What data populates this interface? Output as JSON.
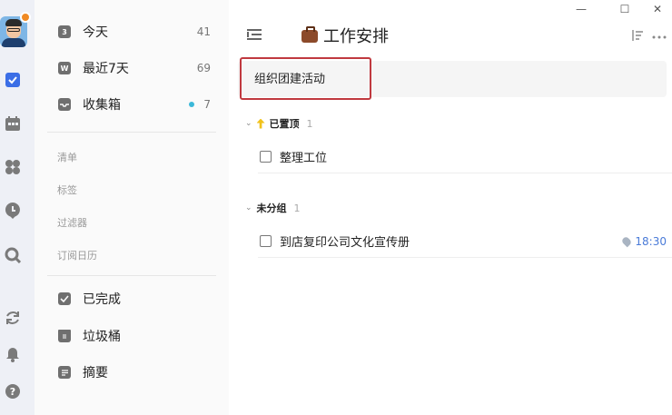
{
  "window": {
    "minimize_glyph": "—",
    "maximize_glyph": "☐",
    "close_glyph": "✕"
  },
  "rail": {
    "icons": [
      "tasks-check-icon",
      "calendar-icon",
      "apps-icon",
      "clock-icon",
      "search-icon",
      "sync-icon",
      "bell-icon",
      "help-icon"
    ],
    "accent": "#3b6ee6"
  },
  "sidebar": {
    "smart_lists": [
      {
        "label": "今天",
        "count": "41",
        "icon": "today-icon",
        "icon_text": "3"
      },
      {
        "label": "最近7天",
        "count": "69",
        "icon": "next7days-icon",
        "icon_text": "W"
      },
      {
        "label": "收集箱",
        "count": "7",
        "icon": "inbox-icon",
        "icon_text": ""
      }
    ],
    "sections": [
      "清单",
      "标签",
      "过滤器",
      "订阅日历"
    ],
    "bottom_items": [
      {
        "label": "已完成",
        "icon": "completed-icon"
      },
      {
        "label": "垃圾桶",
        "icon": "trash-icon"
      },
      {
        "label": "摘要",
        "icon": "summary-icon"
      }
    ],
    "dot_color": "#3bb8d9"
  },
  "main": {
    "title": "工作安排",
    "add_task_value": "组织团建活动",
    "groups": [
      {
        "label": "已置顶",
        "count": "1",
        "tasks": [
          {
            "label": "整理工位",
            "time": ""
          }
        ]
      },
      {
        "label": "未分组",
        "count": "1",
        "tasks": [
          {
            "label": "到店复印公司文化宣传册",
            "time": "18:30"
          }
        ]
      }
    ],
    "highlight_color": "#c0393f",
    "time_color": "#4a7bd8"
  }
}
